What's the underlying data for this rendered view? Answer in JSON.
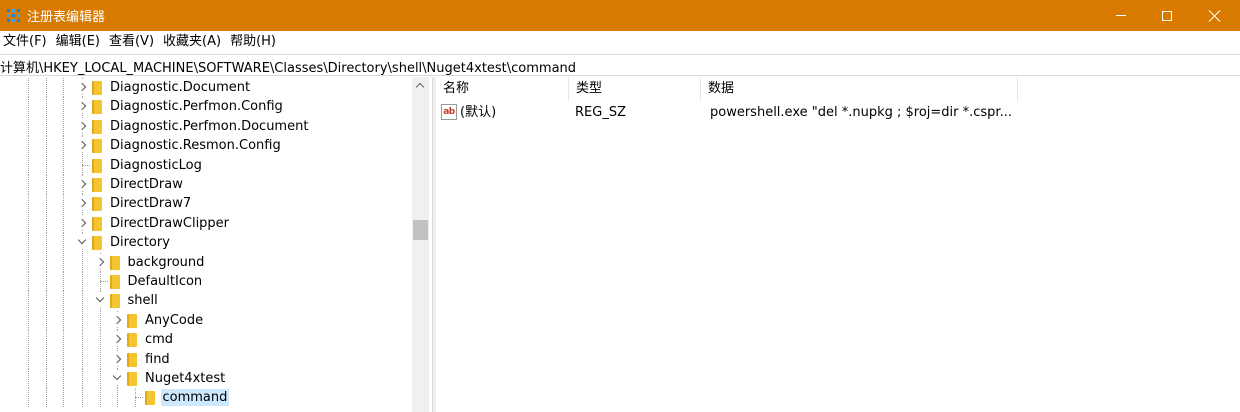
{
  "window": {
    "title": "注册表编辑器",
    "icon": "regedit-icon",
    "accent": "#d87a00"
  },
  "menu": [
    "文件(F)",
    "编辑(E)",
    "查看(V)",
    "收藏夹(A)",
    "帮助(H)"
  ],
  "address": {
    "path": "计算机\\HKEY_LOCAL_MACHINE\\SOFTWARE\\Classes\\Directory\\shell\\Nuget4xtest\\command"
  },
  "tree": {
    "items": [
      {
        "label": "Diagnostic.Document",
        "expander": "collapsed"
      },
      {
        "label": "Diagnostic.Perfmon.Config",
        "expander": "collapsed"
      },
      {
        "label": "Diagnostic.Perfmon.Document",
        "expander": "collapsed"
      },
      {
        "label": "Diagnostic.Resmon.Config",
        "expander": "collapsed"
      },
      {
        "label": "DiagnosticLog",
        "expander": "none"
      },
      {
        "label": "DirectDraw",
        "expander": "collapsed"
      },
      {
        "label": "DirectDraw7",
        "expander": "collapsed"
      },
      {
        "label": "DirectDrawClipper",
        "expander": "collapsed"
      },
      {
        "label": "Directory",
        "expander": "expanded"
      },
      {
        "label": "background",
        "expander": "collapsed"
      },
      {
        "label": "DefaultIcon",
        "expander": "none"
      },
      {
        "label": "shell",
        "expander": "expanded"
      },
      {
        "label": "AnyCode",
        "expander": "collapsed"
      },
      {
        "label": "cmd",
        "expander": "collapsed"
      },
      {
        "label": "find",
        "expander": "collapsed"
      },
      {
        "label": "Nuget4xtest",
        "expander": "expanded"
      },
      {
        "label": "command",
        "expander": "none",
        "selected": true
      }
    ]
  },
  "values": {
    "columns": [
      "名称",
      "类型",
      "数据"
    ],
    "rows": [
      {
        "name": "(默认)",
        "type": "REG_SZ",
        "data": "powershell.exe \"del *.nupkg ; $roj=dir *.cspr..."
      }
    ]
  },
  "colors": {
    "selection": "#cce8ff",
    "folder": "#f4c431"
  }
}
